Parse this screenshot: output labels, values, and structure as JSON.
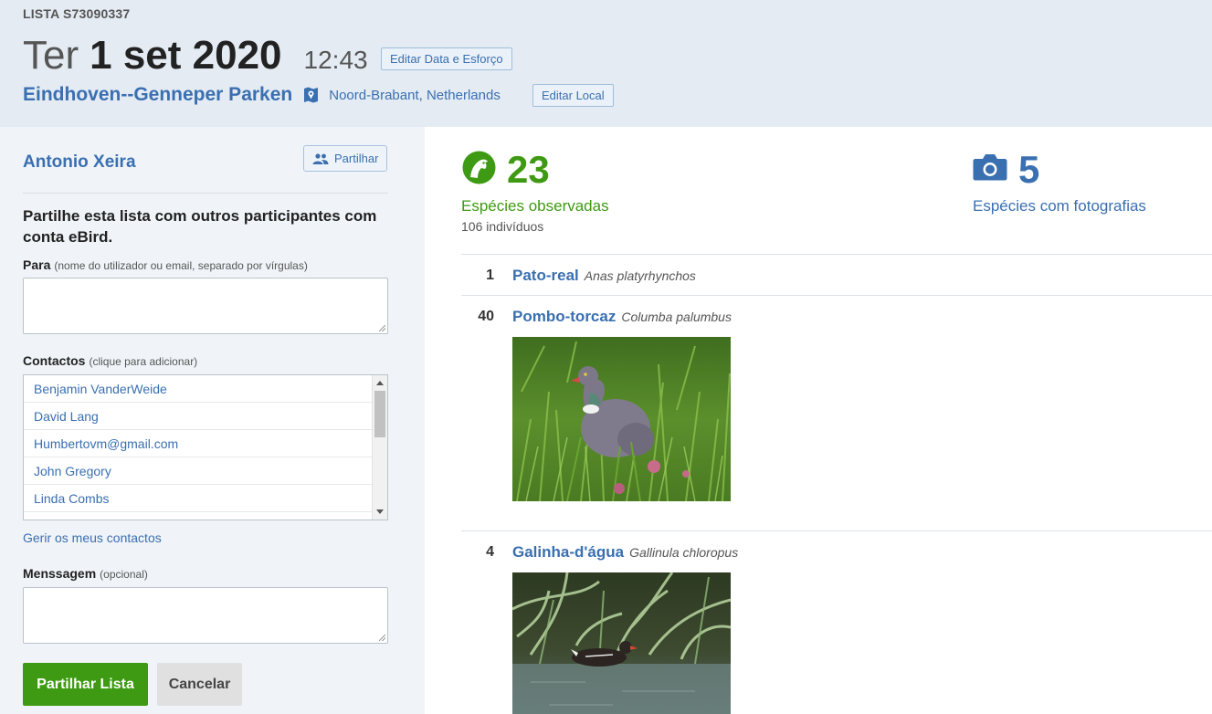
{
  "header": {
    "checklist_id": "LISTA S73090337",
    "weekday": "Ter",
    "date": "1 set 2020",
    "time": "12:43",
    "edit_date_label": "Editar Data e Esforço",
    "location_name": "Eindhoven--Genneper Parken",
    "region": "Noord-Brabant,  Netherlands",
    "edit_location_label": "Editar Local"
  },
  "sidebar": {
    "observer": "Antonio Xeira",
    "share_button": "Partilhar",
    "heading": "Partilhe esta lista com outros participantes com conta eBird.",
    "to_label": "Para",
    "to_hint": "(nome do utilizador ou email, separado por vírgulas)",
    "to_value": "",
    "contacts_label": "Contactos",
    "contacts_hint": "(clique para adicionar)",
    "contacts": [
      "Benjamin VanderWeide",
      "David Lang",
      "Humbertovm@gmail.com",
      "John Gregory",
      "Linda Combs"
    ],
    "manage_contacts": "Gerir os meus contactos",
    "message_label": "Menssagem",
    "message_hint": "(opcional)",
    "message_value": "",
    "submit_label": "Partilhar Lista",
    "cancel_label": "Cancelar"
  },
  "stats": {
    "species_count": "23",
    "species_label": "Espécies observadas",
    "individuals": "106 indivíduos",
    "photo_count": "5",
    "photo_label": "Espécies com fotografias"
  },
  "observations": [
    {
      "count": "1",
      "common": "Pato-real",
      "scientific": "Anas platyrhynchos",
      "has_photo": false
    },
    {
      "count": "40",
      "common": "Pombo-torcaz",
      "scientific": "Columba palumbus",
      "has_photo": true
    },
    {
      "count": "4",
      "common": "Galinha-d'água",
      "scientific": "Gallinula chloropus",
      "has_photo": true
    }
  ],
  "colors": {
    "accent_blue": "#3a6fb0",
    "accent_green": "#3e9a12",
    "header_bg": "#e4ebf3",
    "sidebar_bg": "#f0f4f8"
  }
}
